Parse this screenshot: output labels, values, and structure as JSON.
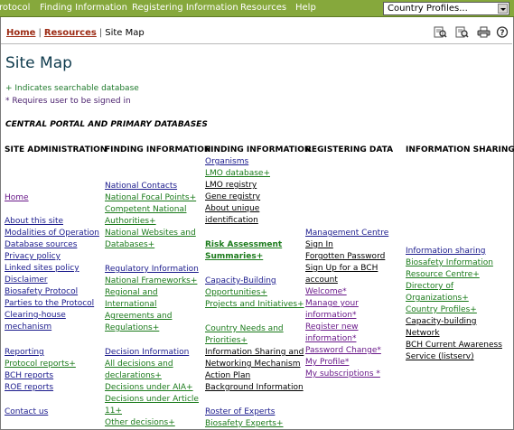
{
  "nav": {
    "items": [
      "rotocol",
      "Finding Information",
      "Registering Information",
      "Resources",
      "Help"
    ],
    "country_select": "Country Profiles..."
  },
  "breadcrumb": {
    "home": "Home",
    "resources": "Resources",
    "current": "Site Map",
    "sep": "|"
  },
  "page_title": "Site Map",
  "legend": {
    "searchable": "+ Indicates searchable database",
    "signin": "* Requires user to be signed in"
  },
  "section_heading": "CENTRAL PORTAL AND PRIMARY DATABASES",
  "columns": {
    "site_admin": {
      "header": "SITE ADMINISTRATION",
      "items": [
        "Home",
        "About this site",
        "Modalities of Operation",
        "Database sources",
        "Privacy policy",
        "Linked sites policy",
        "Disclaimer",
        "Biosafety Protocol",
        "Parties to the Protocol",
        "Clearing-house",
        "mechanism",
        "Reporting",
        "Protocol reports+",
        "BCH reports",
        "ROE reports",
        "Contact us"
      ]
    },
    "finding1": {
      "header": "FINDING INFORMATION",
      "items": [
        "National Contacts",
        "National Focal Points+",
        "Competent National",
        "Authorities+",
        "National Websites and",
        "Databases+",
        "Regulatory Information",
        "National Frameworks+",
        "Regional and",
        "International",
        "Agreements and",
        "Regulations+",
        "Decision Information",
        "All decisions and",
        "declarations+",
        "Decisions under AIA+",
        "Decisions under Article",
        "11+",
        "Other decisions+"
      ]
    },
    "finding2": {
      "header": "FINDING INFORMATION",
      "items": [
        "Organisms",
        "LMO database+",
        "LMO registry",
        "Gene registry",
        "About unique",
        "identification",
        "Risk Assessment",
        "Summaries+",
        "Capacity-Building",
        "Opportunities+",
        "Projects and Initiatives+",
        "Country Needs and",
        "Priorities+",
        "Information Sharing and",
        "Networking Mechanism",
        "Action Plan",
        "Background Information",
        "Roster of Experts",
        "Biosafety Experts+"
      ]
    },
    "registering": {
      "header": "REGISTERING DATA",
      "items": [
        "Management Centre",
        "Sign In",
        "Forgotten Password",
        "Sign Up for a BCH",
        "account",
        "Welcome*",
        "Manage your",
        "information*",
        "Register new",
        "information*",
        "Password Change*",
        "My Profile*",
        "My subscriptions *"
      ]
    },
    "sharing": {
      "header": "INFORMATION SHARING",
      "items": [
        "Information sharing",
        "Biosafety Information",
        "Resource Centre+",
        "Directory of",
        "Organizations+",
        "Country Profiles+",
        "Capacity-building",
        "Network",
        "BCH Current Awareness",
        "Service (listserv)"
      ]
    }
  },
  "colors": {
    "nav_bg": "#86a83c",
    "title": "#0e3a4c",
    "link_blue": "#1a1a8c",
    "link_green": "#1a7a1a",
    "link_purple": "#6a1a8a",
    "crumb": "#9c2b14"
  },
  "toolbar_icons": [
    "find-page-icon",
    "search-page-icon",
    "print-icon",
    "help-icon"
  ]
}
